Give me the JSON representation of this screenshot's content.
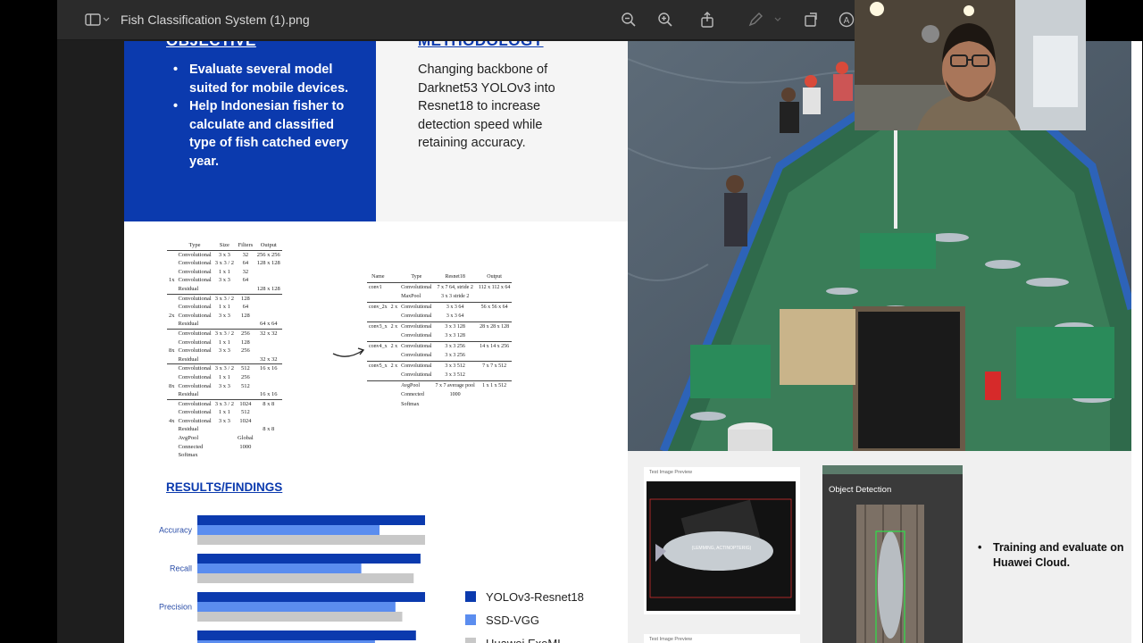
{
  "window": {
    "title": "Fish Classification System (1).png"
  },
  "toolbar": {
    "icons": [
      "sidebar-icon",
      "zoom-out-icon",
      "zoom-in-icon",
      "share-icon",
      "markup-icon",
      "rotate-icon",
      "accessibility-icon"
    ]
  },
  "colors": {
    "brand_blue": "#0b3aae",
    "series_yolo": "#0b3aae",
    "series_ssd": "#5b8def",
    "series_huawei": "#c8c8c8"
  },
  "objective": {
    "heading": "OBJECTIVE",
    "items": [
      "Evaluate several model suited for mobile devices.",
      "Help Indonesian fisher to calculate and classified type of fish catched every year."
    ]
  },
  "methodology": {
    "heading": "METHODOLOGY",
    "text": "Changing backbone of Darknet53 YOLOv3 into Resnet18 to increase detection speed while retaining accuracy."
  },
  "darknet_table": {
    "headers": [
      "",
      "Type",
      "Size",
      "Filters",
      "Output"
    ],
    "rows": [
      [
        "",
        "Convolutional",
        "3 x 3",
        "32",
        "256 x 256"
      ],
      [
        "",
        "Convolutional",
        "3 x 3 / 2",
        "64",
        "128 x 128"
      ],
      [
        "",
        "Convolutional",
        "1 x 1",
        "32",
        ""
      ],
      [
        "1x",
        "Convolutional",
        "3 x 3",
        "64",
        ""
      ],
      [
        "",
        "Residual",
        "",
        "",
        "128 x 128"
      ],
      [
        "",
        "Convolutional",
        "3 x 3 / 2",
        "128",
        ""
      ],
      [
        "",
        "Convolutional",
        "1 x 1",
        "64",
        ""
      ],
      [
        "2x",
        "Convolutional",
        "3 x 3",
        "128",
        ""
      ],
      [
        "",
        "Residual",
        "",
        "",
        "64 x 64"
      ],
      [
        "",
        "Convolutional",
        "3 x 3 / 2",
        "256",
        "32 x 32"
      ],
      [
        "",
        "Convolutional",
        "1 x 1",
        "128",
        ""
      ],
      [
        "8x",
        "Convolutional",
        "3 x 3",
        "256",
        ""
      ],
      [
        "",
        "Residual",
        "",
        "",
        "32 x 32"
      ],
      [
        "",
        "Convolutional",
        "3 x 3 / 2",
        "512",
        "16 x 16"
      ],
      [
        "",
        "Convolutional",
        "1 x 1",
        "256",
        ""
      ],
      [
        "8x",
        "Convolutional",
        "3 x 3",
        "512",
        ""
      ],
      [
        "",
        "Residual",
        "",
        "",
        "16 x 16"
      ],
      [
        "",
        "Convolutional",
        "3 x 3 / 2",
        "1024",
        "8 x 8"
      ],
      [
        "",
        "Convolutional",
        "1 x 1",
        "512",
        ""
      ],
      [
        "4x",
        "Convolutional",
        "3 x 3",
        "1024",
        ""
      ],
      [
        "",
        "Residual",
        "",
        "",
        "8 x 8"
      ],
      [
        "",
        "AvgPool",
        "",
        "Global",
        ""
      ],
      [
        "",
        "Connected",
        "",
        "1000",
        ""
      ],
      [
        "",
        "Softmax",
        "",
        "",
        ""
      ]
    ]
  },
  "resnet_table": {
    "headers": [
      "Name",
      "",
      "Type",
      "Resnet18",
      "Output"
    ],
    "rows": [
      [
        "conv1",
        "",
        "Convolutional",
        "7 x 7      64, stride 2",
        "112 x 112 x 64"
      ],
      [
        "",
        "",
        "MaxPool",
        "3 x 3      stride 2",
        ""
      ],
      [
        "conv_2x",
        "2 x",
        "Convolutional",
        "3 x 3      64",
        "56 x 56 x 64"
      ],
      [
        "",
        "",
        "Convolutional",
        "3 x 3      64",
        ""
      ],
      [
        "conv3_x",
        "2 x",
        "Convolutional",
        "3 x 3      128",
        "28 x 28 x 128"
      ],
      [
        "",
        "",
        "Convolutional",
        "3 x 3      128",
        ""
      ],
      [
        "conv4_x",
        "2 x",
        "Convolutional",
        "3 x 3      256",
        "14 x 14 x 256"
      ],
      [
        "",
        "",
        "Convolutional",
        "3 x 3      256",
        ""
      ],
      [
        "conv5_x",
        "2 x",
        "Convolutional",
        "3 x 3      512",
        "7 x 7 x 512"
      ],
      [
        "",
        "",
        "Convolutional",
        "3 x 3      512",
        ""
      ],
      [
        "",
        "",
        "AvgPool",
        "7 x 7 average pool",
        "1 x 1 x 512"
      ],
      [
        "",
        "",
        "Connected",
        "1000",
        ""
      ],
      [
        "",
        "",
        "Softmax",
        "",
        ""
      ]
    ]
  },
  "results": {
    "heading": "RESULTS/FINDINGS"
  },
  "chart_data": {
    "type": "bar",
    "orientation": "horizontal",
    "categories": [
      "Accuracy",
      "Recall",
      "Precision",
      ""
    ],
    "series": [
      {
        "name": "YOLOv3-Resnet18",
        "values": [
          1.0,
          0.98,
          1.0,
          0.96
        ]
      },
      {
        "name": "SSD-VGG",
        "values": [
          0.8,
          0.72,
          0.87,
          0.78
        ]
      },
      {
        "name": "Huawei ExeML",
        "values": [
          1.0,
          0.95,
          0.9,
          0.0
        ]
      }
    ],
    "legend_position": "right"
  },
  "previews": {
    "preview1_label": "Test Image Preview",
    "preview1_detection": "(LEMMING, ACTINOPTERIG)",
    "preview2_label": "Test Image Preview",
    "phone_title": "Object Detection"
  },
  "training": {
    "items": [
      "Training and evaluate on Huawei Cloud."
    ]
  }
}
